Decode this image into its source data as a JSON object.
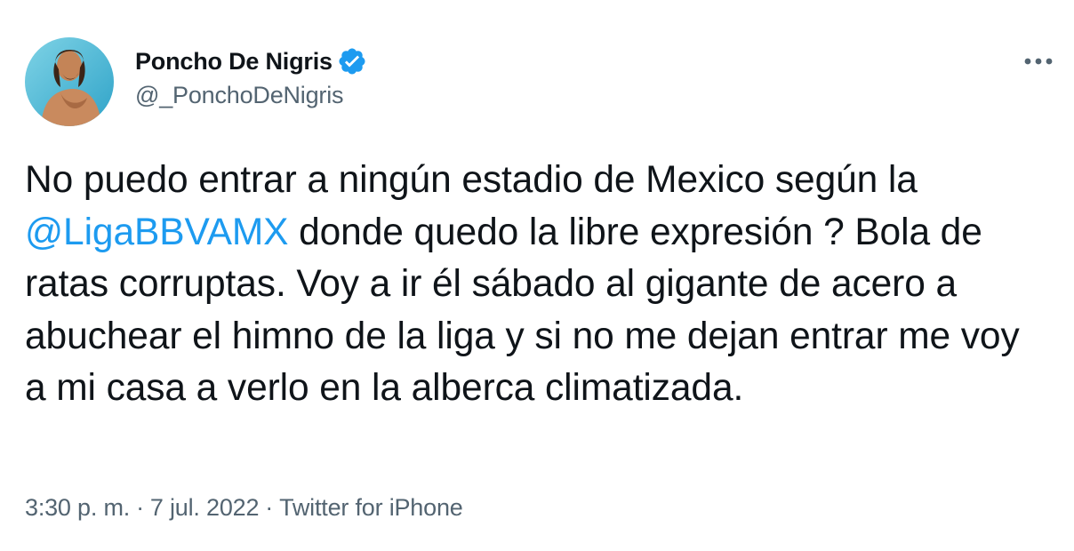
{
  "author": {
    "display_name": "Poncho De Nigris",
    "handle": "@_PonchoDeNigris",
    "verified": true
  },
  "tweet": {
    "segments": [
      {
        "type": "text",
        "text": "No puedo entrar a ningún estadio de Mexico según la "
      },
      {
        "type": "mention",
        "text": "@LigaBBVAMX"
      },
      {
        "type": "text",
        "text": " donde quedo la libre expresión ? Bola de ratas corruptas. Voy a ir él sábado al gigante de acero a abuchear el himno de la liga y si no me dejan entrar me voy a mi casa a verlo en la alberca climatizada."
      }
    ],
    "time": "3:30 p. m.",
    "separator": "·",
    "date": "7 jul. 2022",
    "source": "Twitter for iPhone"
  },
  "icons": {
    "verified": "verified-badge-icon",
    "more": "more-options-icon"
  },
  "colors": {
    "text": "#0f1419",
    "secondary": "#536471",
    "link": "#1d9bf0",
    "verified": "#1d9bf0"
  }
}
